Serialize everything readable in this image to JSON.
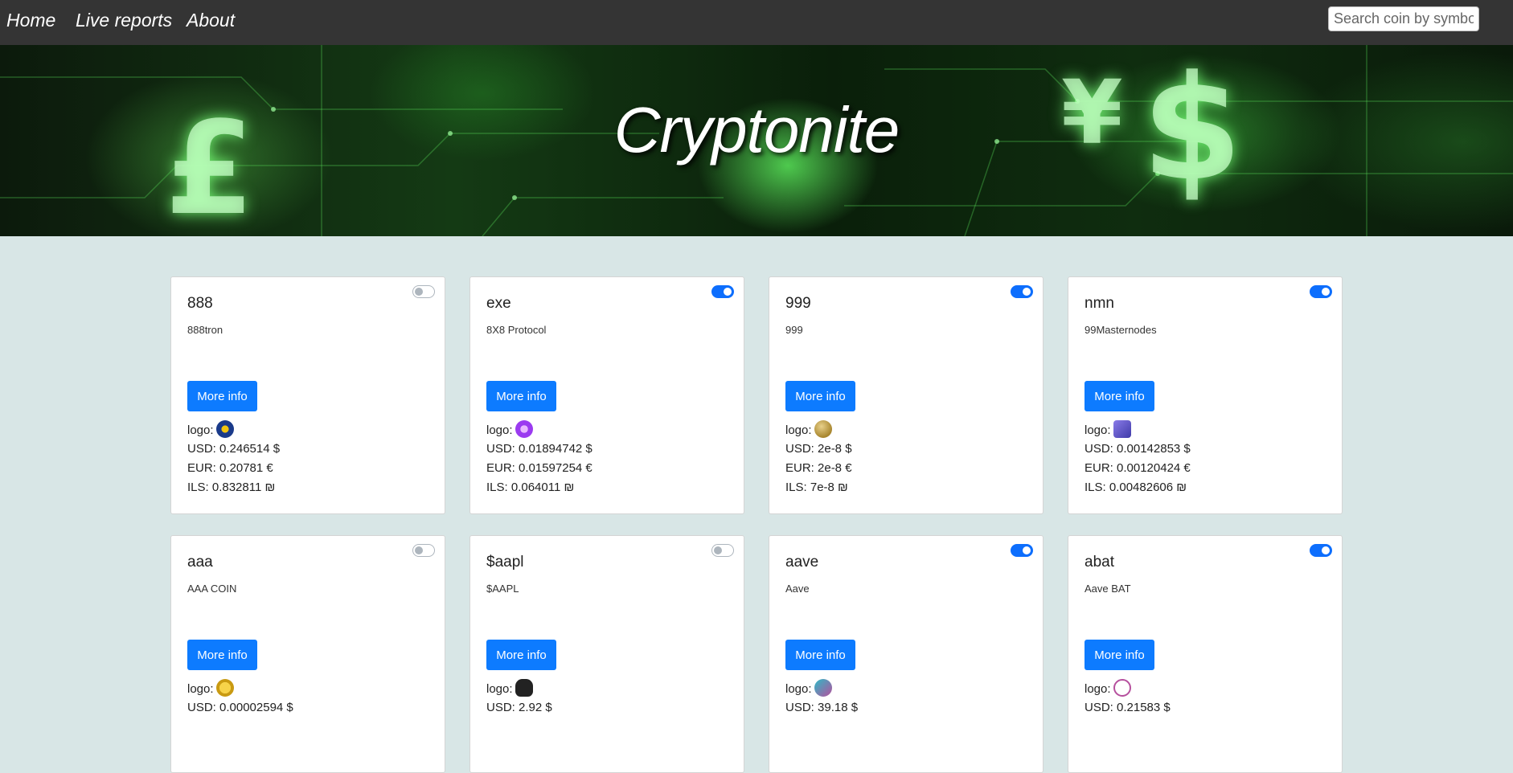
{
  "nav": {
    "home": "Home",
    "live_reports": "Live reports",
    "about": "About",
    "search_placeholder": "Search coin by symbol.."
  },
  "hero": {
    "title": "Cryptonite"
  },
  "cards": [
    {
      "symbol": "888",
      "name": "888tron",
      "more": "More info",
      "logo_label": "logo:",
      "logo_icon": "888tron-logo-icon",
      "usd": "USD: 0.246514 $",
      "eur": "EUR: 0.20781 €",
      "ils": "ILS: 0.832811 ₪",
      "toggle_on": false
    },
    {
      "symbol": "exe",
      "name": "8X8 Protocol",
      "more": "More info",
      "logo_label": "logo:",
      "logo_icon": "8x8-protocol-logo-icon",
      "usd": "USD: 0.01894742 $",
      "eur": "EUR: 0.01597254 €",
      "ils": "ILS: 0.064011 ₪",
      "toggle_on": true
    },
    {
      "symbol": "999",
      "name": "999",
      "more": "More info",
      "logo_label": "logo:",
      "logo_icon": "999-logo-icon",
      "usd": "USD: 2e-8 $",
      "eur": "EUR: 2e-8 €",
      "ils": "ILS: 7e-8 ₪",
      "toggle_on": true
    },
    {
      "symbol": "nmn",
      "name": "99Masternodes",
      "more": "More info",
      "logo_label": "logo:",
      "logo_icon": "99masternodes-logo-icon",
      "usd": "USD: 0.00142853 $",
      "eur": "EUR: 0.00120424 €",
      "ils": "ILS: 0.00482606 ₪",
      "toggle_on": true
    },
    {
      "symbol": "aaa",
      "name": "AAA COIN",
      "more": "More info",
      "logo_label": "logo:",
      "logo_icon": "aaa-coin-logo-icon",
      "usd": "USD: 0.00002594 $",
      "eur": "",
      "ils": "",
      "toggle_on": false
    },
    {
      "symbol": "$aapl",
      "name": "$AAPL",
      "more": "More info",
      "logo_label": "logo:",
      "logo_icon": "aapl-logo-icon",
      "usd": "USD: 2.92 $",
      "eur": "",
      "ils": "",
      "toggle_on": false
    },
    {
      "symbol": "aave",
      "name": "Aave",
      "more": "More info",
      "logo_label": "logo:",
      "logo_icon": "aave-logo-icon",
      "usd": "USD: 39.18 $",
      "eur": "",
      "ils": "",
      "toggle_on": true
    },
    {
      "symbol": "abat",
      "name": "Aave BAT",
      "more": "More info",
      "logo_label": "logo:",
      "logo_icon": "aave-bat-logo-icon",
      "usd": "USD: 0.21583 $",
      "eur": "",
      "ils": "",
      "toggle_on": true
    }
  ]
}
